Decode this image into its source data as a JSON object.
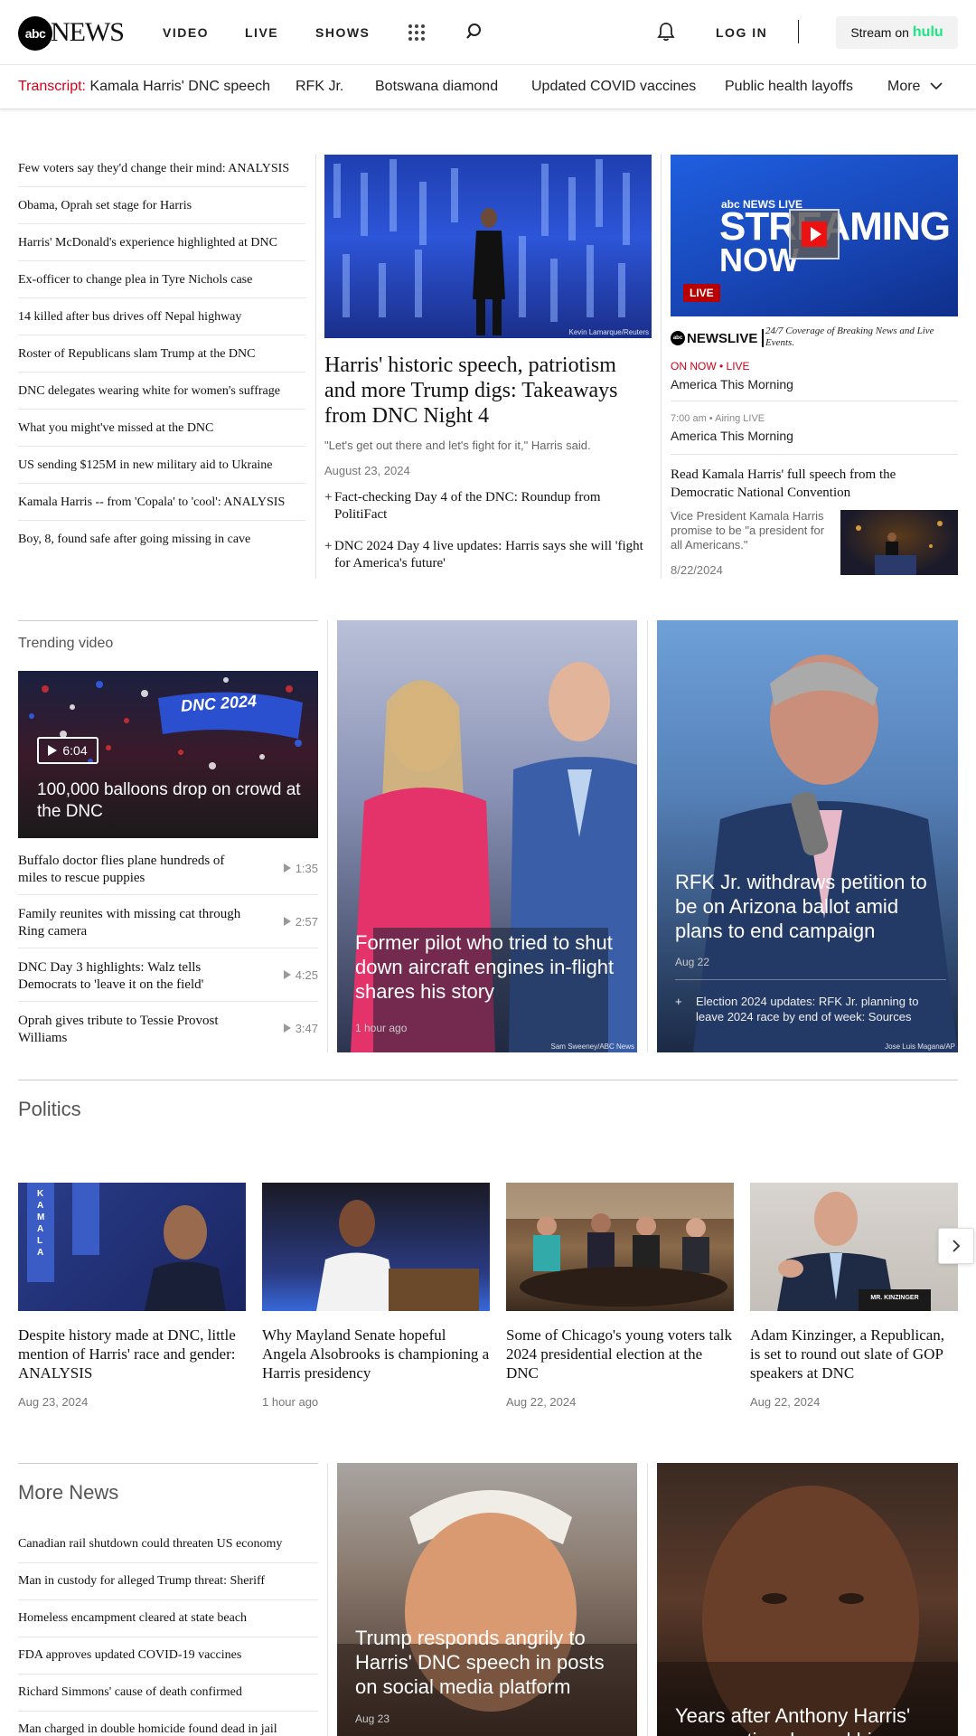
{
  "header": {
    "logo_abc": "abc",
    "logo_news": "NEWS",
    "nav": [
      "VIDEO",
      "LIVE",
      "SHOWS"
    ],
    "login": "LOG IN",
    "stream_label": "Stream on",
    "stream_brand": "hulu"
  },
  "trending_bar": {
    "transcript_prefix": "Transcript:",
    "transcript_text": "Kamala Harris' DNC speech",
    "items": [
      "RFK Jr.",
      "Botswana diamond",
      "Updated COVID vaccines",
      "Public health layoffs"
    ],
    "more": "More"
  },
  "headlines": [
    "Few voters say they'd change their mind: ANALYSIS",
    "Obama, Oprah set stage for Harris",
    "Harris' McDonald's experience highlighted at DNC",
    "Ex-officer to change plea in Tyre Nichols case",
    "14 killed after bus drives off Nepal highway",
    "Roster of Republicans slam Trump at the DNC",
    "DNC delegates wearing white for women's suffrage",
    "What you might've missed at the DNC",
    "US sending $125M in new military aid to Ukraine",
    "Kamala Harris -- from 'Copala' to 'cool': ANALYSIS",
    "Boy, 8, found safe after going missing in cave"
  ],
  "lead_story": {
    "credit": "Kevin Lamarque/Reuters",
    "title": "Harris' historic speech, patriotism and more Trump digs: Takeaways from DNC Night 4",
    "quote": "\"Let's get out there and let's fight for it,\" Harris said.",
    "date": "August 23, 2024",
    "related": [
      "Fact-checking Day 4 of the DNC: Roundup from PolitiFact",
      "DNC 2024 Day 4 live updates: Harris says she will 'fight for America's future'"
    ]
  },
  "live": {
    "promo_top": "abc NEWS LIVE",
    "promo_line1": "STREAMING",
    "promo_line2": "NOW",
    "badge": "LIVE",
    "brand": "NEWSLIVE",
    "tagline": "24/7 Coverage of Breaking News and Live Events.",
    "now_label": "ON NOW • LIVE",
    "now_show": "America This Morning",
    "next_time": "7:00 am",
    "next_label": "Airing LIVE",
    "next_show": "America This Morning",
    "feature_title": "Read Kamala Harris' full speech from the Democratic National Convention",
    "feature_desc": "Vice President Kamala Harris promise to be \"a president for all Americans.\"",
    "feature_date": "8/22/2024"
  },
  "trending_video": {
    "heading": "Trending video",
    "hero_duration": "6:04",
    "hero_title": "100,000 balloons drop on crowd at the DNC",
    "hero_banner": "DNC 2024",
    "items": [
      {
        "title": "Buffalo doctor flies plane hundreds of miles to rescue puppies",
        "duration": "1:35"
      },
      {
        "title": "Family reunites with missing cat through Ring camera",
        "duration": "2:57"
      },
      {
        "title": "DNC Day 3 highlights: Walz tells Democrats to 'leave it on the field'",
        "duration": "4:25"
      },
      {
        "title": "Oprah gives tribute to Tessie Provost Williams",
        "duration": "3:47"
      }
    ]
  },
  "feature_pilot": {
    "title": "Former pilot who tried to shut down aircraft engines in-flight shares his story",
    "time": "1 hour ago",
    "credit": "Sam Sweeney/ABC News"
  },
  "feature_rfk": {
    "title": "RFK Jr. withdraws petition to be on Arizona ballot amid plans to end campaign",
    "time": "Aug 22",
    "related": "Election 2024 updates: RFK Jr. planning to leave 2024 race by end of week: Sources",
    "credit": "Jose Luis Magana/AP"
  },
  "politics": {
    "heading": "Politics",
    "cards": [
      {
        "title": "Despite history made at DNC, little mention of Harris' race and gender: ANALYSIS",
        "date": "Aug 23, 2024",
        "sign": "KAMALA"
      },
      {
        "title": "Why Mayland Senate hopeful Angela Alsobrooks is championing a Harris presidency",
        "date": "1 hour ago"
      },
      {
        "title": "Some of Chicago's young voters talk 2024 presidential election at the DNC",
        "date": "Aug 22, 2024"
      },
      {
        "title": "Adam Kinzinger, a Republican, is set to round out slate of GOP speakers at DNC",
        "date": "Aug 22, 2024",
        "placard": "MR. KINZINGER"
      }
    ]
  },
  "more_news": {
    "heading": "More News",
    "items": [
      "Canadian rail shutdown could threaten US economy",
      "Man in custody for alleged Trump threat: Sheriff",
      "Homeless encampment cleared at state beach",
      "FDA approves updated COVID-19 vaccines",
      "Richard Simmons' cause of death confirmed",
      "Man charged in double homicide found dead in jail"
    ],
    "trump_title": "Trump responds angrily to Harris' DNC speech in posts on social media platform",
    "trump_time": "Aug 23",
    "harris_title": "Years after Anthony Harris' exoneration, he and his"
  },
  "colors": {
    "accent_red": "#d0021b",
    "hulu_green": "#1ce783",
    "live_blue": "#1847b8"
  }
}
